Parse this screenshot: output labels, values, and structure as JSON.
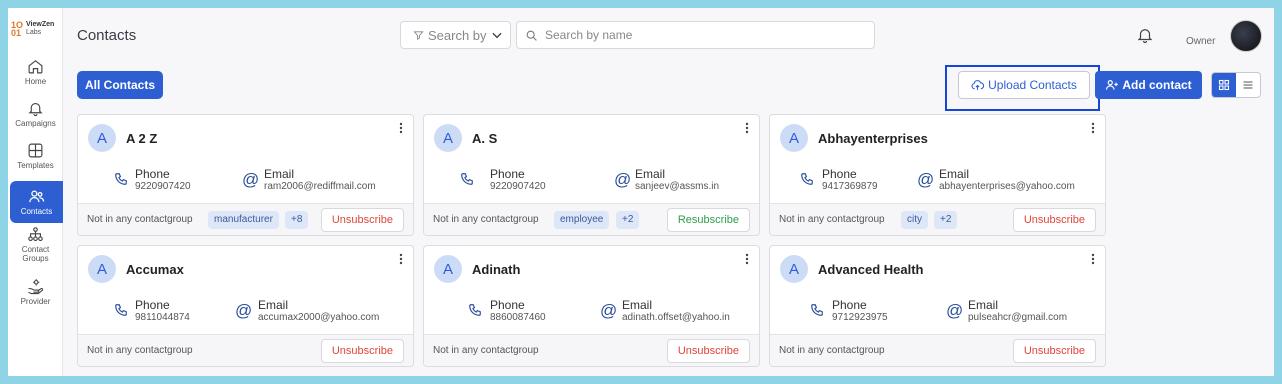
{
  "sidebar": {
    "logo": {
      "mark": "1O\n01",
      "name": "ViewZen",
      "sub": "Labs"
    },
    "items": [
      {
        "label": "Home",
        "icon": "home-icon"
      },
      {
        "label": "Campaigns",
        "icon": "bell-icon"
      },
      {
        "label": "Templates",
        "icon": "grid-icon"
      },
      {
        "label": "Contacts",
        "icon": "users-icon",
        "active": true
      },
      {
        "label": "Contact\nGroups",
        "icon": "hierarchy-icon"
      },
      {
        "label": "Provider",
        "icon": "hand-gear-icon"
      }
    ]
  },
  "header": {
    "title": "Contacts",
    "filter_label": "Search by",
    "search_placeholder": "Search by name",
    "user_role": "Owner"
  },
  "toolbar": {
    "all_contacts": "All Contacts",
    "upload": "Upload Contacts",
    "add": "Add contact"
  },
  "colors": {
    "accent": "#2d5fd3",
    "highlight_outline": "#1646d8",
    "unsubscribe": "#e0443a",
    "resubscribe": "#2e9e48"
  },
  "labels": {
    "phone": "Phone",
    "email": "Email"
  },
  "contacts": [
    {
      "initial": "A",
      "name": "A 2 Z",
      "phone": "9220907420",
      "email": "ram2006@rediffmail.com",
      "group": "Not in any contactgroup",
      "tags": [
        "manufacturer",
        "+8"
      ],
      "action": "Unsubscribe"
    },
    {
      "initial": "A",
      "name": "A. S",
      "phone": "9220907420",
      "email": "sanjeev@assms.in",
      "group": "Not in any contactgroup",
      "tags": [
        "employee",
        "+2"
      ],
      "action": "Resubscribe"
    },
    {
      "initial": "A",
      "name": "Abhayenterprises",
      "phone": "9417369879",
      "email": "abhayenterprises@yahoo.com",
      "group": "Not in any contactgroup",
      "tags": [
        "city",
        "+2"
      ],
      "action": "Unsubscribe"
    },
    {
      "initial": "A",
      "name": "Accumax",
      "phone": "9811044874",
      "email": "accumax2000@yahoo.com",
      "group": "Not in any contactgroup",
      "tags": [],
      "action": "Unsubscribe"
    },
    {
      "initial": "A",
      "name": "Adinath",
      "phone": "8860087460",
      "email": "adinath.offset@yahoo.in",
      "group": "Not in any contactgroup",
      "tags": [],
      "action": "Unsubscribe"
    },
    {
      "initial": "A",
      "name": "Advanced Health",
      "phone": "9712923975",
      "email": "pulseahcr@gmail.com",
      "group": "Not in any contactgroup",
      "tags": [],
      "action": "Unsubscribe"
    }
  ]
}
